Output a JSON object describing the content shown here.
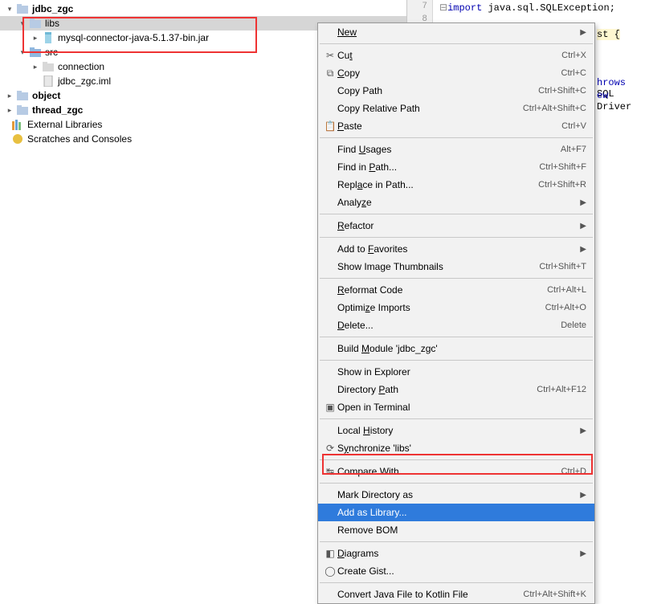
{
  "tree": {
    "jdbc_zgc": "jdbc_zgc",
    "libs": "libs",
    "jar": "mysql-connector-java-5.1.37-bin.jar",
    "src": "src",
    "connection": "connection",
    "iml": "jdbc_zgc.iml",
    "object": "object",
    "thread_zgc": "thread_zgc",
    "ext": "External Libraries",
    "scratch": "Scratches and Consoles"
  },
  "editor": {
    "line7": "7",
    "line8": "8",
    "import": "import",
    "imp_rest": " java.sql.SQLException;",
    "st_brace": "st {",
    "throws": "hrows",
    "sql": " SQL",
    "new": "ew",
    "driver": " Driver"
  },
  "menu": {
    "new": "New",
    "cut": "Cut",
    "cut_u": "t",
    "cut_pre": "Cu",
    "cut_sc": "Ctrl+X",
    "copy": "Copy",
    "copy_u": "C",
    "copy_rest": "opy",
    "copy_sc": "Ctrl+C",
    "copypath": "Copy Path",
    "copypath_sc": "Ctrl+Shift+C",
    "copyrel": "Copy Relative Path",
    "copyrel_sc": "Ctrl+Alt+Shift+C",
    "paste": "Paste",
    "paste_u": "P",
    "paste_rest": "aste",
    "paste_sc": "Ctrl+V",
    "findu": "Find Usages",
    "findu_u": "U",
    "findu_pre": "Find ",
    "findu_rest": "sages",
    "findu_sc": "Alt+F7",
    "findp": "Find in Path...",
    "findp_u": "P",
    "findp_pre": "Find in ",
    "findp_rest": "ath...",
    "findp_sc": "Ctrl+Shift+F",
    "repl": "Replace in Path...",
    "repl_u": "a",
    "repl_sc": "Ctrl+Shift+R",
    "analyze": "Analyze",
    "analyze_u": "z",
    "refactor": "Refactor",
    "refactor_u": "R",
    "fav": "Add to Favorites",
    "fav_u": "F",
    "fav_pre": "Add to ",
    "fav_rest": "avorites",
    "thumbs": "Show Image Thumbnails",
    "thumbs_sc": "Ctrl+Shift+T",
    "reformat": "Reformat Code",
    "reformat_u": "R",
    "reformat_rest": "eformat Code",
    "reformat_sc": "Ctrl+Alt+L",
    "optim": "Optimize Imports",
    "optim_u": "z",
    "optim_sc": "Ctrl+Alt+O",
    "delete": "Delete...",
    "delete_u": "D",
    "delete_rest": "elete...",
    "delete_sc": "Delete",
    "build": "Build Module 'jdbc_zgc'",
    "build_u": "M",
    "explorer": "Show in Explorer",
    "dpath": "Directory Path",
    "dpath_u": "P",
    "dpath_pre": "Directory ",
    "dpath_rest": "ath",
    "dpath_sc": "Ctrl+Alt+F12",
    "term": "Open in Terminal",
    "localh": "Local History",
    "localh_u": "H",
    "localh_pre": "Local ",
    "localh_rest": "istory",
    "sync": "Synchronize 'libs'",
    "sync_u": "y",
    "compare": "Compare With...",
    "compare_sc": "Ctrl+D",
    "markdir": "Mark Directory as",
    "addlib": "Add as Library...",
    "bom": "Remove BOM",
    "diagrams": "Diagrams",
    "diagrams_u": "D",
    "diagrams_rest": "iagrams",
    "gist": "Create Gist...",
    "kotlin": "Convert Java File to Kotlin File",
    "kotlin_sc": "Ctrl+Alt+Shift+K"
  }
}
